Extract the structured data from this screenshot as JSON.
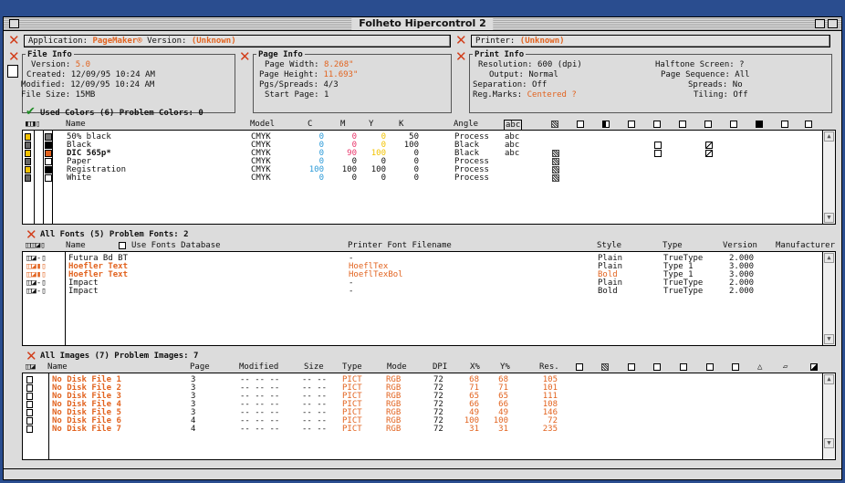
{
  "window": {
    "title": "Folheto Hipercontrol 2"
  },
  "app_bar": {
    "app_label": "Application:",
    "app_value": "PageMaker®",
    "version_label": "Version:",
    "version_value": "(Unknown)"
  },
  "printer_bar": {
    "label": "Printer:",
    "value": "(Unknown)"
  },
  "file_info": {
    "title": "File Info",
    "version_label": "Version:",
    "version_value": "5.0",
    "created_label": "Created:",
    "created_value": "12/09/95 10:24 AM",
    "modified_label": "Modified:",
    "modified_value": "12/09/95 10:24 AM",
    "size_label": "File Size:",
    "size_value": "15MB"
  },
  "page_info": {
    "title": "Page Info",
    "width_label": "Page Width:",
    "width_value": "8.268\"",
    "height_label": "Page Height:",
    "height_value": "11.693\"",
    "pgs_label": "Pgs/Spreads:",
    "pgs_value": "4/3",
    "start_label": "Start Page:",
    "start_value": "1"
  },
  "print_info": {
    "title": "Print Info",
    "resolution_label": "Resolution:",
    "resolution_value": "600 (dpi)",
    "output_label": "Output:",
    "output_value": "Normal",
    "separation_label": "Separation:",
    "separation_value": "Off",
    "regmarks_label": "Reg.Marks:",
    "regmarks_value": "Centered ?",
    "halftone_label": "Halftone Screen:",
    "halftone_value": "?",
    "pageseq_label": "Page Sequence:",
    "pageseq_value": "All",
    "spreads_label": "Spreads:",
    "spreads_value": "No",
    "tiling_label": "Tiling:",
    "tiling_value": "Off"
  },
  "colors": {
    "heading": "Used Colors (6)  Problem Colors: 0",
    "headers": {
      "name": "Name",
      "model": "Model",
      "c": "C",
      "m": "M",
      "y": "Y",
      "k": "K",
      "angle": "Angle",
      "abc": "abc"
    },
    "rows": [
      {
        "name": "50% black",
        "model": "CMYK",
        "c": "0",
        "m": "0",
        "y": "0",
        "k": "50",
        "angle": "Process",
        "abc": "abc",
        "swatch": "#7a7a7a"
      },
      {
        "name": "Black",
        "model": "CMYK",
        "c": "0",
        "m": "0",
        "y": "0",
        "k": "100",
        "angle": "Black",
        "abc": "abc",
        "swatch": "#000000"
      },
      {
        "name": "DIC 565p*",
        "model": "CMYK",
        "c": "0",
        "m": "90",
        "y": "100",
        "k": "0",
        "angle": "Black",
        "abc": "abc",
        "swatch": "#e2631f"
      },
      {
        "name": "Paper",
        "model": "CMYK",
        "c": "0",
        "m": "0",
        "y": "0",
        "k": "0",
        "angle": "Process",
        "abc": "",
        "swatch": "#ffffff"
      },
      {
        "name": "Registration",
        "model": "CMYK",
        "c": "100",
        "m": "100",
        "y": "100",
        "k": "0",
        "angle": "Process",
        "abc": "",
        "swatch": "#000000"
      },
      {
        "name": "White",
        "model": "CMYK",
        "c": "0",
        "m": "0",
        "y": "0",
        "k": "0",
        "angle": "Process",
        "abc": "",
        "swatch": "#ffffff"
      }
    ]
  },
  "fonts": {
    "heading": "All Fonts (5)  Problem Fonts: 2",
    "use_db_label": "Use Fonts Database",
    "headers": {
      "name": "Name",
      "printer": "Printer Font Filename",
      "style": "Style",
      "type": "Type",
      "version": "Version",
      "manufacturer": "Manufacturer"
    },
    "rows": [
      {
        "name": "Futura Bd BT",
        "printer": "-",
        "style": "Plain",
        "type": "TrueType",
        "version": "2.000",
        "problem": false
      },
      {
        "name": "Hoefler Text",
        "printer": "HoeflTex",
        "style": "Plain",
        "type": "Type 1",
        "version": "3.000",
        "problem": true
      },
      {
        "name": "Hoefler Text",
        "printer": "HoeflTexBol",
        "style": "Bold",
        "type": "Type 1",
        "version": "3.000",
        "problem": true
      },
      {
        "name": "Impact",
        "printer": "-",
        "style": "Plain",
        "type": "TrueType",
        "version": "2.000",
        "problem": false
      },
      {
        "name": "Impact",
        "printer": "-",
        "style": "Bold",
        "type": "TrueType",
        "version": "2.000",
        "problem": false
      }
    ]
  },
  "images": {
    "heading": "All Images (7)  Problem Images: 7",
    "headers": {
      "name": "Name",
      "page": "Page",
      "modified": "Modified",
      "size": "Size",
      "type": "Type",
      "mode": "Mode",
      "dpi": "DPI",
      "xp": "X%",
      "yp": "Y%",
      "res": "Res."
    },
    "rows": [
      {
        "name": "No Disk File   1",
        "page": "3",
        "modified": "-- -- --",
        "size": "-- --",
        "type": "PICT",
        "mode": "RGB",
        "dpi": "72",
        "xp": "68",
        "yp": "68",
        "res": "105"
      },
      {
        "name": "No Disk File   2",
        "page": "3",
        "modified": "-- -- --",
        "size": "-- --",
        "type": "PICT",
        "mode": "RGB",
        "dpi": "72",
        "xp": "71",
        "yp": "71",
        "res": "101"
      },
      {
        "name": "No Disk File   3",
        "page": "3",
        "modified": "-- -- --",
        "size": "-- --",
        "type": "PICT",
        "mode": "RGB",
        "dpi": "72",
        "xp": "65",
        "yp": "65",
        "res": "111"
      },
      {
        "name": "No Disk File   4",
        "page": "3",
        "modified": "-- -- --",
        "size": "-- --",
        "type": "PICT",
        "mode": "RGB",
        "dpi": "72",
        "xp": "66",
        "yp": "66",
        "res": "108"
      },
      {
        "name": "No Disk File   5",
        "page": "3",
        "modified": "-- -- --",
        "size": "-- --",
        "type": "PICT",
        "mode": "RGB",
        "dpi": "72",
        "xp": "49",
        "yp": "49",
        "res": "146"
      },
      {
        "name": "No Disk File   6",
        "page": "4",
        "modified": "-- -- --",
        "size": "-- --",
        "type": "PICT",
        "mode": "RGB",
        "dpi": "72",
        "xp": "100",
        "yp": "100",
        "res": "72"
      },
      {
        "name": "No Disk File   7",
        "page": "4",
        "modified": "-- -- --",
        "size": "-- --",
        "type": "PICT",
        "mode": "RGB",
        "dpi": "72",
        "xp": "31",
        "yp": "31",
        "res": "235"
      }
    ]
  },
  "colors_accent": {
    "problem": "#e2631f",
    "ok": "#1f8c25",
    "desktop": "#2a4d8f"
  }
}
